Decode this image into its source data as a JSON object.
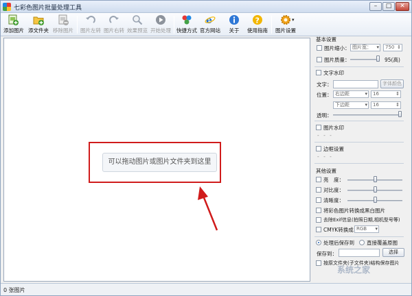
{
  "window": {
    "title": "七彩色图片批量处理工具"
  },
  "titlebar_buttons": {
    "minimize": "–",
    "maximize": "□",
    "close": "✕"
  },
  "toolbar": [
    {
      "id": "add-image",
      "label": "添加图片",
      "icon": "add-image-icon",
      "enabled": true
    },
    {
      "id": "add-folder",
      "label": "添文件夹",
      "icon": "add-folder-icon",
      "enabled": true
    },
    {
      "id": "remove-image",
      "label": "移除图片",
      "icon": "remove-image-icon",
      "enabled": false
    },
    {
      "id": "rotate-left",
      "label": "图片左转",
      "icon": "rotate-left-icon",
      "enabled": false
    },
    {
      "id": "rotate-right",
      "label": "图片右转",
      "icon": "rotate-right-icon",
      "enabled": false
    },
    {
      "id": "preview",
      "label": "效果预览",
      "icon": "magnifier-icon",
      "enabled": false
    },
    {
      "id": "start",
      "label": "开始处理",
      "icon": "play-icon",
      "enabled": false
    },
    {
      "id": "shortcut",
      "label": "快捷方式",
      "icon": "shapes-icon",
      "enabled": true
    },
    {
      "id": "website",
      "label": "官方网站",
      "icon": "ie-icon",
      "enabled": true
    },
    {
      "id": "about",
      "label": "关于",
      "icon": "info-icon",
      "enabled": true
    },
    {
      "id": "guide",
      "label": "使用指南",
      "icon": "help-icon",
      "enabled": true
    },
    {
      "id": "settings",
      "label": "图片设置",
      "icon": "gear-icon",
      "enabled": true
    }
  ],
  "canvas": {
    "drop_hint": "可以拖动图片或图片文件夹到这里"
  },
  "panel": {
    "basic": {
      "heading": "基本设置",
      "shrink_label": "图片缩小：",
      "shrink_select": "图片宽：",
      "shrink_value": "750",
      "quality_label": "图片质量：",
      "quality_value": "95(高)"
    },
    "text_watermark": {
      "heading": "文字水印",
      "text_label": "文字：",
      "font_color_button": "字体颜色",
      "position_label": "位置：",
      "pos_h": "右边距",
      "pos_h_value": "16",
      "pos_v": "下边距",
      "pos_v_value": "16",
      "opacity_label": "透明："
    },
    "image_watermark": {
      "heading": "图片水印",
      "dots": "- - -"
    },
    "border": {
      "heading": "边框设置",
      "dots": "- - -"
    },
    "other": {
      "heading": "其他设置",
      "brightness": "亮　度：",
      "contrast": "对比度：",
      "sharpness": "清晰度：",
      "grayscale": "将彩色图片转换成黑白图片",
      "remove_exif": "去除Exif信息(拍照日期,相机型号等)",
      "cmyk_label": "CMYK转换成：",
      "cmyk_value": "RGB"
    },
    "output": {
      "save_after": "处理后保存到",
      "overwrite": "直接覆盖原图",
      "save_to_label": "保存到：",
      "choose_button": "选择",
      "keep_structure": "按原文件夹(子文件夹)结构保存图片"
    }
  },
  "statusbar": {
    "count_text": "0 张图片"
  },
  "watermark_text": "系统之家"
}
